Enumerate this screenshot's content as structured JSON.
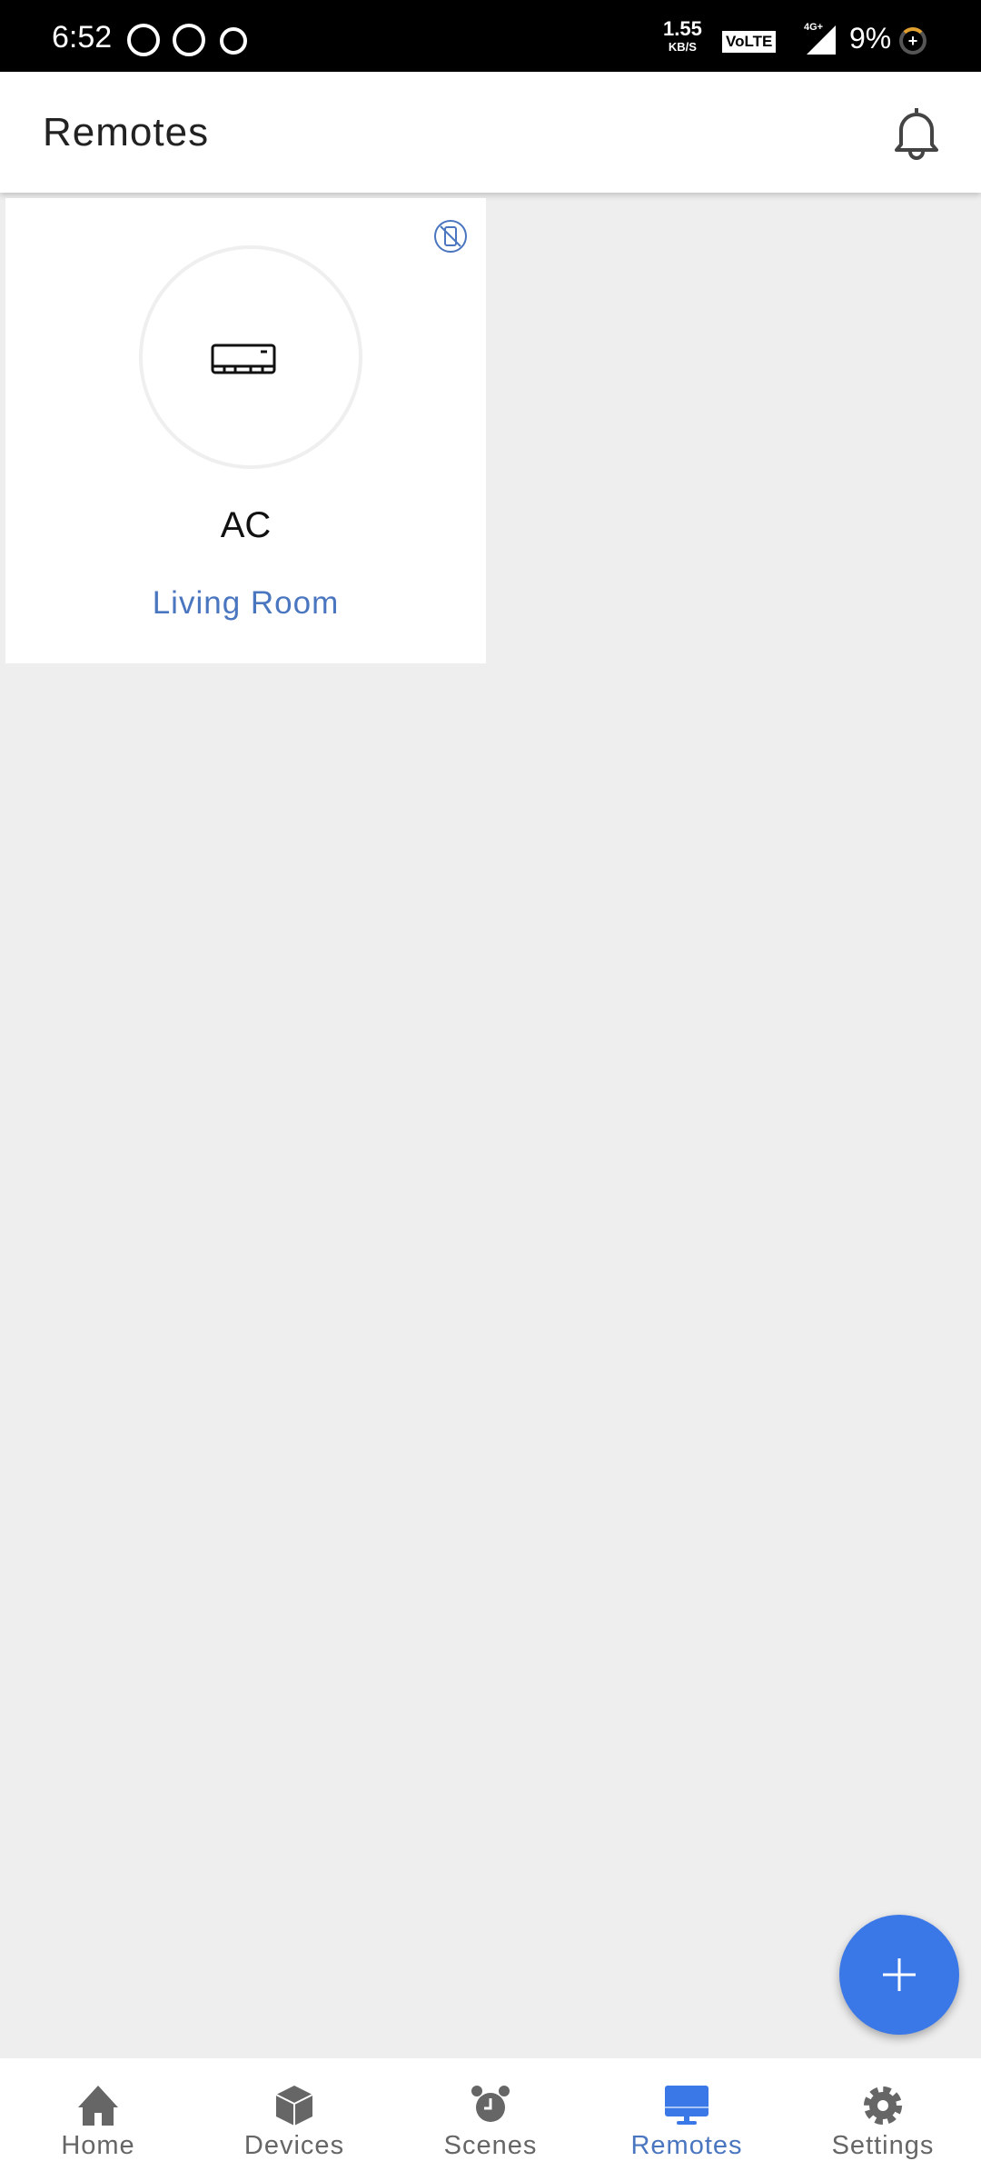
{
  "status_bar": {
    "time": "6:52",
    "speed": "1.55",
    "speed_unit": "KB/S",
    "volte": "VoLTE",
    "network": "4G+",
    "battery": "9%",
    "notification_icons": [
      "camera-app-icon",
      "whatsapp-icon",
      "location-app-icon"
    ]
  },
  "app_bar": {
    "title": "Remotes",
    "action_icon": "bell-icon"
  },
  "remotes": [
    {
      "name": "AC",
      "room": "Living Room",
      "device_icon": "air-conditioner-icon",
      "status_icon": "device-offline-icon"
    }
  ],
  "fab": {
    "icon": "plus-icon"
  },
  "bottom_nav": {
    "items": [
      {
        "label": "Home",
        "icon": "home-icon"
      },
      {
        "label": "Devices",
        "icon": "cube-icon"
      },
      {
        "label": "Scenes",
        "icon": "alarm-clock-icon"
      },
      {
        "label": "Remotes",
        "icon": "monitor-icon",
        "active": true
      },
      {
        "label": "Settings",
        "icon": "gear-icon"
      }
    ]
  },
  "colors": {
    "accent": "#3b78e7",
    "room_text": "#4a76c0",
    "inactive_nav": "#666666",
    "background": "#eeeeee"
  }
}
